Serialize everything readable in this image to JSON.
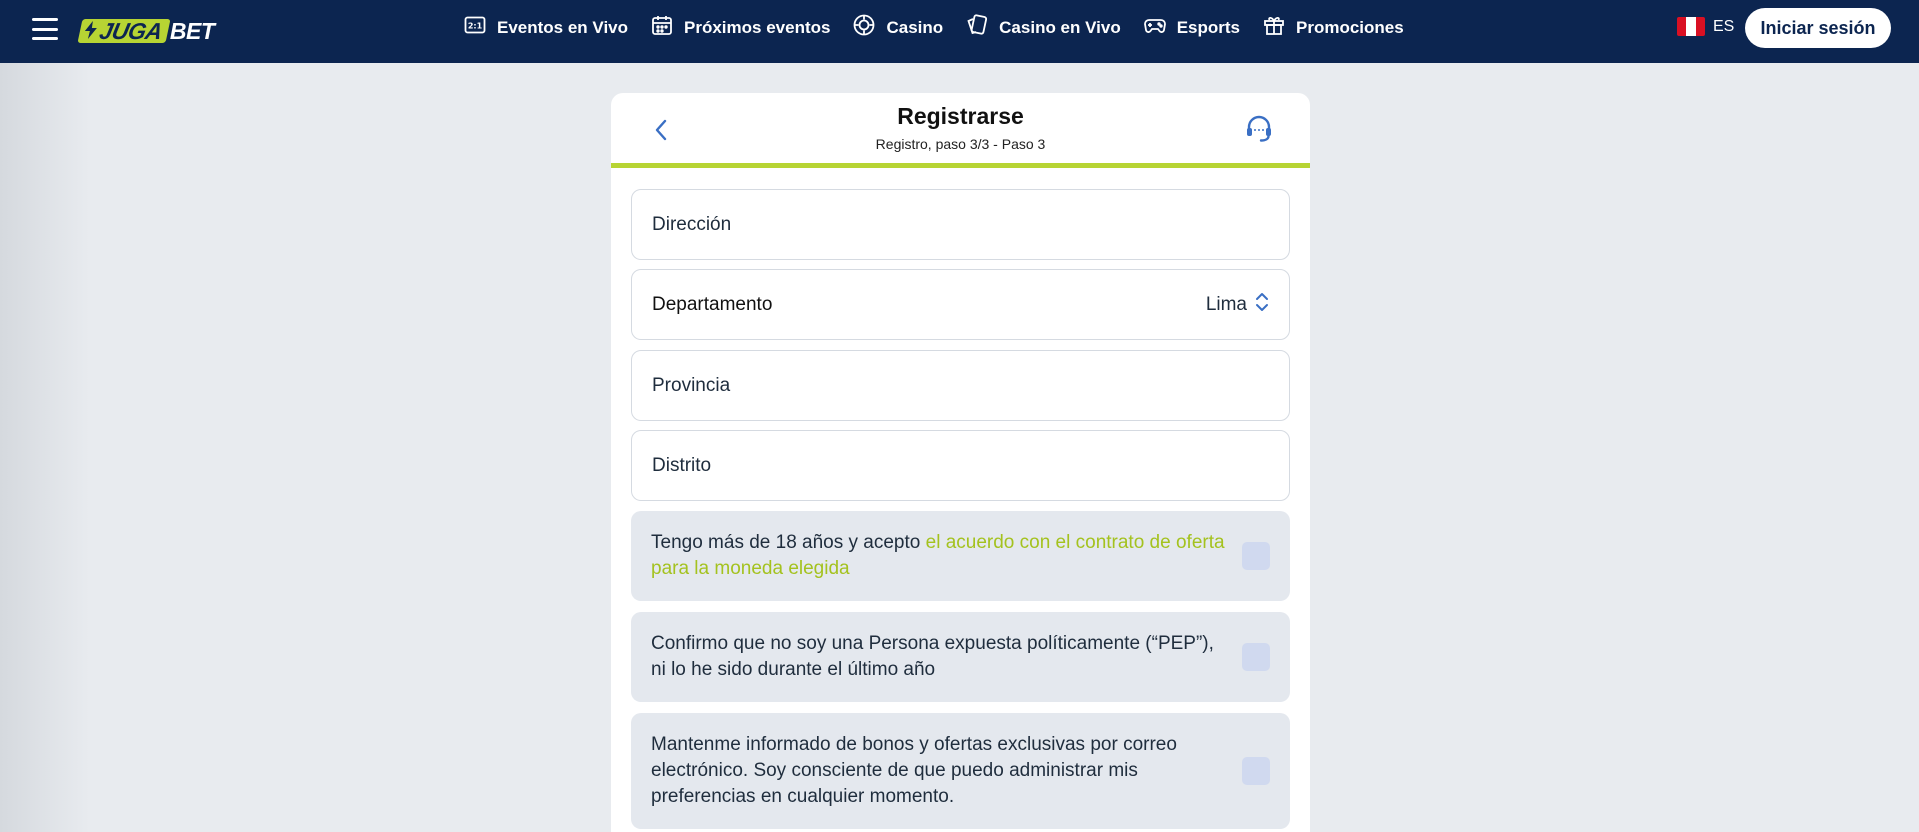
{
  "header": {
    "logo": {
      "mark": "JUGA",
      "suffix": "BET"
    },
    "nav": [
      {
        "label": "Eventos en Vivo",
        "icon": "live-events-icon"
      },
      {
        "label": "Próximos eventos",
        "icon": "calendar-icon"
      },
      {
        "label": "Casino",
        "icon": "casino-chip-icon"
      },
      {
        "label": "Casino en Vivo",
        "icon": "cards-icon"
      },
      {
        "label": "Esports",
        "icon": "gamepad-icon"
      },
      {
        "label": "Promociones",
        "icon": "gift-icon"
      }
    ],
    "language": "ES",
    "login_label": "Iniciar sesión"
  },
  "registration": {
    "title": "Registrarse",
    "subtitle": "Registro, paso 3/3 - Paso 3",
    "progress_fraction": 1.0,
    "fields": {
      "address": {
        "placeholder": "Dirección",
        "value": ""
      },
      "department": {
        "label": "Departamento",
        "value": "Lima"
      },
      "province": {
        "placeholder": "Provincia",
        "value": ""
      },
      "district": {
        "placeholder": "Distrito",
        "value": ""
      }
    },
    "consents": {
      "age": {
        "text": "Tengo más de 18 años y acepto ",
        "link": "el acuerdo con el contrato de oferta para la moneda elegida",
        "checked": false
      },
      "pep": {
        "text": "Confirmo que no soy una Persona expuesta políticamente (“PEP”), ni lo he sido durante el último año",
        "checked": false
      },
      "marketing": {
        "text": "Mantenme informado de bonos y ofertas exclusivas por correo electrónico. Soy consciente de que puedo administrar mis preferencias en cualquier momento.",
        "checked": false
      }
    }
  },
  "colors": {
    "header_bg": "#0c2550",
    "accent_green": "#b7d433",
    "link_green": "#a4c21f",
    "icon_blue": "#3a6fc4",
    "page_bg": "#e8ebef"
  }
}
